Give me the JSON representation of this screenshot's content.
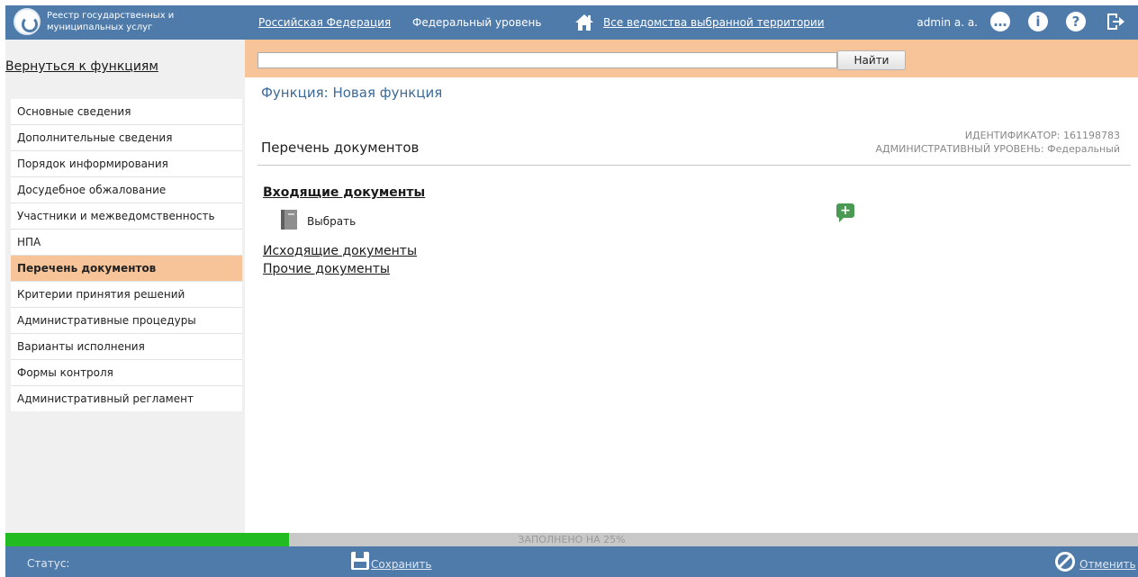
{
  "header": {
    "brand_line1": "Реестр государственных и",
    "brand_line2": "муниципальных услуг",
    "territory": "Российская Федерация",
    "level": "Федеральный уровень",
    "departments": "Все ведомства выбранной территории",
    "user": "admin a. a.",
    "icons": [
      "chat-icon",
      "info-icon",
      "help-icon",
      "logout-icon"
    ]
  },
  "sidebar": {
    "back_link": "Вернуться к функциям",
    "items": [
      {
        "label": "Основные сведения"
      },
      {
        "label": "Дополнительные сведения"
      },
      {
        "label": "Порядок информирования"
      },
      {
        "label": "Досудебное обжалование"
      },
      {
        "label": "Участники и межведомственность"
      },
      {
        "label": "НПА"
      },
      {
        "label": "Перечень документов",
        "active": true
      },
      {
        "label": "Критерии принятия решений"
      },
      {
        "label": "Административные процедуры"
      },
      {
        "label": "Варианты исполнения"
      },
      {
        "label": "Формы контроля"
      },
      {
        "label": "Административный регламент"
      }
    ]
  },
  "search": {
    "value": "",
    "button": "Найти"
  },
  "main": {
    "function_title": "Функция: Новая функция",
    "section_title": "Перечень документов",
    "identifier": "ИДЕНТИФИКАТОР: 161198783",
    "admin_level": "АДМИНИСТРАТИВНЫЙ УРОВЕНЬ: Федеральный",
    "incoming": "Входящие документы",
    "select": "Выбрать",
    "outgoing": "Исходящие документы",
    "other": "Прочие документы",
    "add_icon": "+"
  },
  "progress": {
    "text": "ЗАПОЛНЕНО НА 25%",
    "percent": 25
  },
  "footer": {
    "status_label": "Статус:",
    "save": "Сохранить",
    "cancel": "Отменить"
  },
  "colors": {
    "header_bg": "#4f7bab",
    "accent_orange": "#f7c49a",
    "progress_green": "#22bb22"
  }
}
